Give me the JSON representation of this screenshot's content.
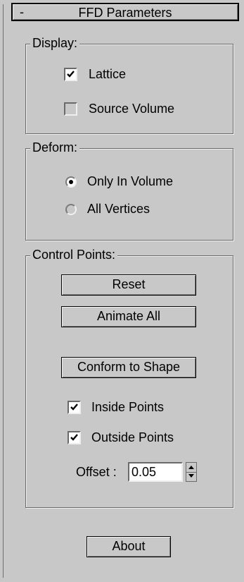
{
  "rollout": {
    "toggle": "-",
    "title": "FFD Parameters"
  },
  "display": {
    "label": "Display:",
    "lattice": {
      "label": "Lattice",
      "checked": true
    },
    "source_volume": {
      "label": "Source Volume",
      "checked": false
    }
  },
  "deform": {
    "label": "Deform:",
    "options": [
      {
        "label": "Only In Volume",
        "selected": true
      },
      {
        "label": "All Vertices",
        "selected": false
      }
    ]
  },
  "control_points": {
    "label": "Control Points:",
    "reset_label": "Reset",
    "animate_all_label": "Animate All",
    "conform_label": "Conform to Shape",
    "inside_points": {
      "label": "Inside Points",
      "checked": true
    },
    "outside_points": {
      "label": "Outside Points",
      "checked": true
    },
    "offset_label": "Offset :",
    "offset_value": "0.05"
  },
  "about_label": "About"
}
